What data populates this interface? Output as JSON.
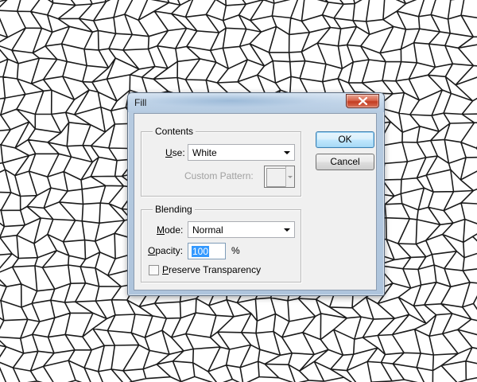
{
  "window": {
    "title": "Fill"
  },
  "contents": {
    "group_label": "Contents",
    "use_label_u": "U",
    "use_label_rest": "se:",
    "use_value": "White",
    "custom_pattern_label": "Custom Pattern:"
  },
  "blending": {
    "group_label": "Blending",
    "mode_label_u": "M",
    "mode_label_rest": "ode:",
    "mode_value": "Normal",
    "opacity_label_u": "O",
    "opacity_label_rest": "pacity:",
    "opacity_value": "100",
    "opacity_unit": "%",
    "preserve_label_u": "P",
    "preserve_label_rest": "reserve Transparency",
    "preserve_checked": false
  },
  "buttons": {
    "ok": "OK",
    "cancel": "Cancel"
  },
  "icons": {
    "close": "close-icon",
    "dropdown": "chevron-down-icon"
  },
  "colors": {
    "selection": "#3399ff",
    "close_button": "#c33c22",
    "dialog_face": "#f0f0f0"
  }
}
